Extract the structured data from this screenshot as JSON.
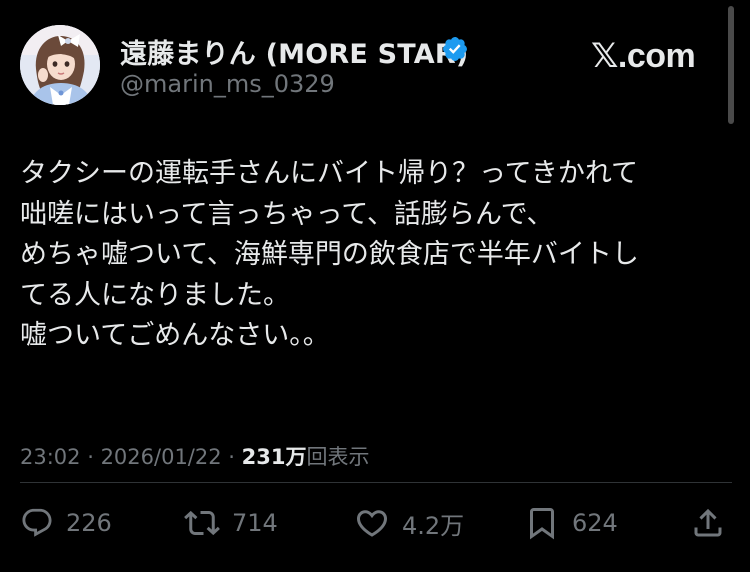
{
  "author": {
    "display_name": "遠藤まりん (MORE STAR)",
    "handle": "@marin_ms_0329",
    "verified": true,
    "verified_color": "#1d9bf0",
    "avatar": "profile-photo"
  },
  "brand": {
    "logo_letter": "𝕏",
    "domain": ".com"
  },
  "post": {
    "lines": [
      "タクシーの運転手さんにバイト帰り？ってきかれて",
      "咄嗟にはいって言っちゃって、話膨らんで、",
      "めちゃ嘘ついて、海鮮専門の飲食店で半年バイトし",
      "てる人になりました。",
      "嘘ついてごめんなさい。。"
    ]
  },
  "meta": {
    "time": "23:02",
    "separator": " · ",
    "date": "2026/01/22",
    "views_count": "231万",
    "views_label": "回表示"
  },
  "actions": {
    "replies": {
      "count": "226",
      "icon": "reply-icon"
    },
    "reposts": {
      "count": "714",
      "icon": "repost-icon"
    },
    "likes": {
      "count": "4.2万",
      "icon": "heart-icon"
    },
    "bookmarks": {
      "count": "624",
      "icon": "bookmark-icon"
    },
    "share": {
      "icon": "share-icon"
    }
  },
  "colors": {
    "background": "#000000",
    "text_primary": "#e7e9ea",
    "text_secondary": "#71767b",
    "divider": "#2f3336"
  }
}
